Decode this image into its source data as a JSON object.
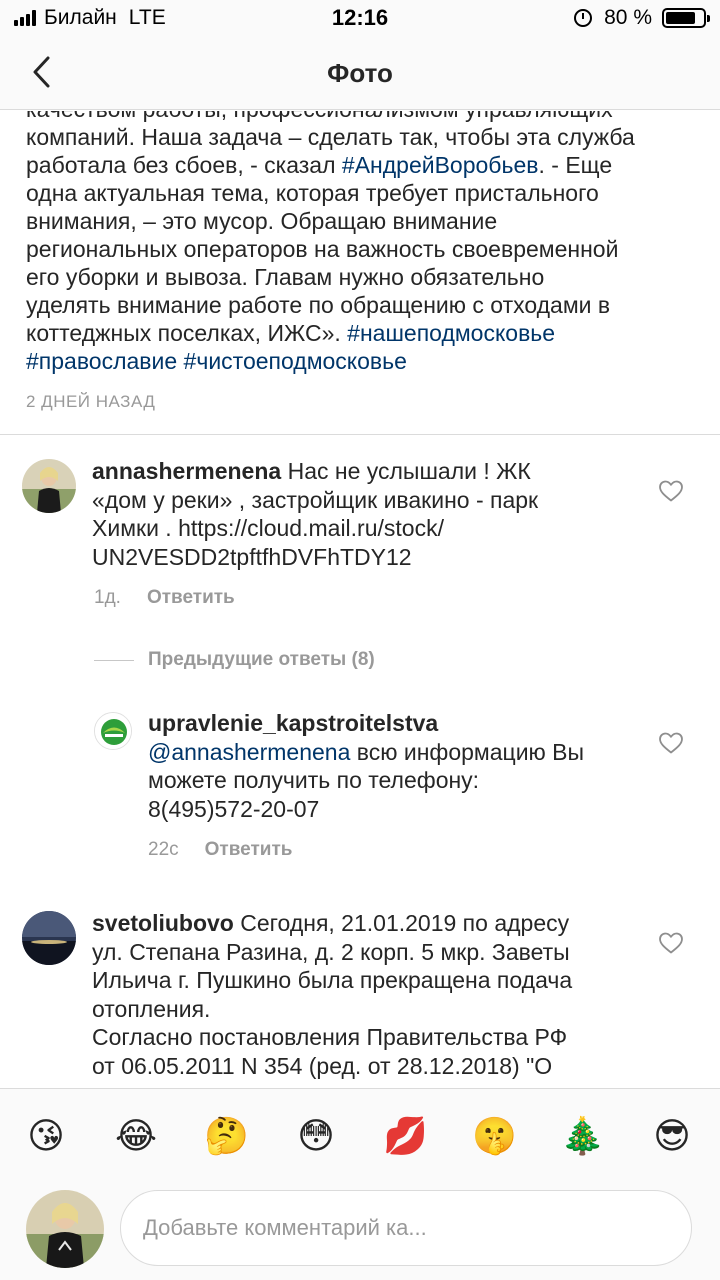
{
  "status_bar": {
    "carrier": "Билайн",
    "network": "LTE",
    "time": "12:16",
    "battery": "80 %",
    "battery_level": 0.8
  },
  "header": {
    "title": "Фото"
  },
  "caption": {
    "line1": "качеством работы, профессионализмом управляющих",
    "line2": "компаний. Наша задача – сделать так, чтобы эта служба",
    "line3a": "работала без сбоев, - сказал ",
    "line3_tag": "#АндрейВоробьев",
    "line3b": ". - Еще",
    "line4": "одна актуальная тема, которая требует пристального",
    "line5": "внимания, – это мусор. Обращаю внимание",
    "line6": "региональных операторов на важность своевременной",
    "line7": "его уборки и вывоза. Главам нужно обязательно",
    "line8": "уделять внимание работе по обращению с отходами в",
    "line9a": "коттеджных поселках, ИЖС». ",
    "line9_tag": "#нашеподмосковье",
    "line10_tag1": "#православие",
    "line10_tag2": "#чистоеподмосковье",
    "time_ago": "2 ДНЕЙ НАЗАД"
  },
  "comments": [
    {
      "username": "annashermenena",
      "lines": [
        " Нас не услышали ! ЖК",
        "«дом у реки» , застройщик ивакино - парк",
        "Химки . https://cloud.mail.ru/stock/",
        "UN2VESDD2tpftfhDVFhTDY12"
      ],
      "time": "1д.",
      "reply_label": "Ответить"
    },
    {
      "username": "upravlenie_kapstroitelstva",
      "mention": "@annashermenena",
      "lines": [
        " всю информацию Вы",
        "можете получить по телефону:",
        "8(495)572-20-07"
      ],
      "time": "22с",
      "reply_label": "Ответить"
    },
    {
      "username": "svetoliubovo",
      "lines": [
        " Сегодня, 21.01.2019 по адресу",
        "ул. Степана Разина, д. 2 корп. 5 мкр. Заветы",
        "Ильича г. Пушкино была прекращена подача",
        "отопления.",
        "Согласно постановления Правительства РФ",
        "от 06.05.2011 N 354 (ред. от 28.12.2018) \"О"
      ]
    }
  ],
  "previous_replies": "Предыдущие ответы (8)",
  "emoji_bar": [
    "😘",
    "😂",
    "🤔",
    "😳",
    "💋",
    "🤫",
    "🎄",
    "😎"
  ],
  "input": {
    "placeholder": "Добавьте комментарий ка..."
  },
  "colors": {
    "hashtag": "#003569",
    "secondary_text": "#999999",
    "primary_text": "#262626",
    "divider": "#dbdbdb"
  }
}
